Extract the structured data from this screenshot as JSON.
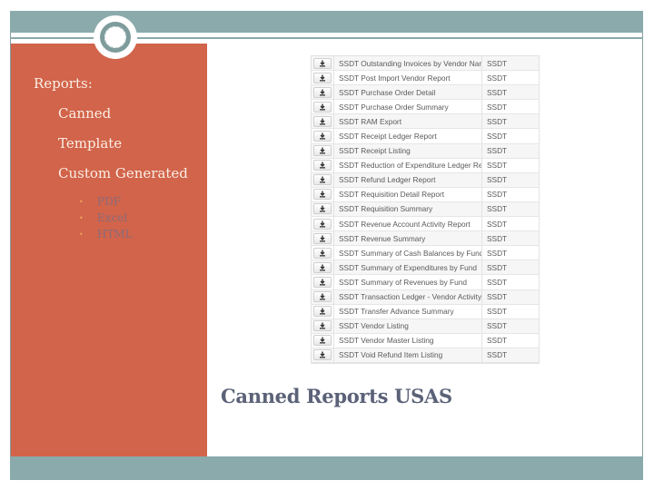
{
  "slide": {
    "colors": {
      "accent_band": "#8aaaab",
      "left_panel": "#d1644a",
      "heading_text": "#fbeee6",
      "sub_bullet_text": "#8b6a7c",
      "sub_bullet_marker": "#f2a15a",
      "caption_text": "#5b6278"
    },
    "bullets": {
      "heading": "Reports:",
      "items": [
        {
          "label": "Canned"
        },
        {
          "label": "Template"
        },
        {
          "label": "Custom Generated"
        }
      ],
      "sub_items": [
        {
          "label": "PDF"
        },
        {
          "label": "Excel"
        },
        {
          "label": "HTML"
        }
      ]
    },
    "report_table": {
      "download_icon": "download-icon",
      "rows": [
        {
          "name": "SSDT Outstanding Invoices by Vendor Name",
          "type": "SSDT"
        },
        {
          "name": "SSDT Post Import Vendor Report",
          "type": "SSDT"
        },
        {
          "name": "SSDT Purchase Order Detail",
          "type": "SSDT"
        },
        {
          "name": "SSDT Purchase Order Summary",
          "type": "SSDT"
        },
        {
          "name": "SSDT RAM Export",
          "type": "SSDT"
        },
        {
          "name": "SSDT Receipt Ledger Report",
          "type": "SSDT"
        },
        {
          "name": "SSDT Receipt Listing",
          "type": "SSDT"
        },
        {
          "name": "SSDT Reduction of Expenditure Ledger Report",
          "type": "SSDT"
        },
        {
          "name": "SSDT Refund Ledger Report",
          "type": "SSDT"
        },
        {
          "name": "SSDT Requisition Detail Report",
          "type": "SSDT"
        },
        {
          "name": "SSDT Requisition Summary",
          "type": "SSDT"
        },
        {
          "name": "SSDT Revenue Account Activity Report",
          "type": "SSDT"
        },
        {
          "name": "SSDT Revenue Summary",
          "type": "SSDT"
        },
        {
          "name": "SSDT Summary of Cash Balances by Fund",
          "type": "SSDT"
        },
        {
          "name": "SSDT Summary of Expenditures by Fund",
          "type": "SSDT"
        },
        {
          "name": "SSDT Summary of Revenues by Fund",
          "type": "SSDT"
        },
        {
          "name": "SSDT Transaction Ledger - Vendor Activity",
          "type": "SSDT"
        },
        {
          "name": "SSDT Transfer Advance Summary",
          "type": "SSDT"
        },
        {
          "name": "SSDT Vendor Listing",
          "type": "SSDT"
        },
        {
          "name": "SSDT Vendor Master Listing",
          "type": "SSDT"
        },
        {
          "name": "SSDT Void Refund Item Listing",
          "type": "SSDT"
        }
      ]
    },
    "caption": "Canned Reports USAS"
  }
}
